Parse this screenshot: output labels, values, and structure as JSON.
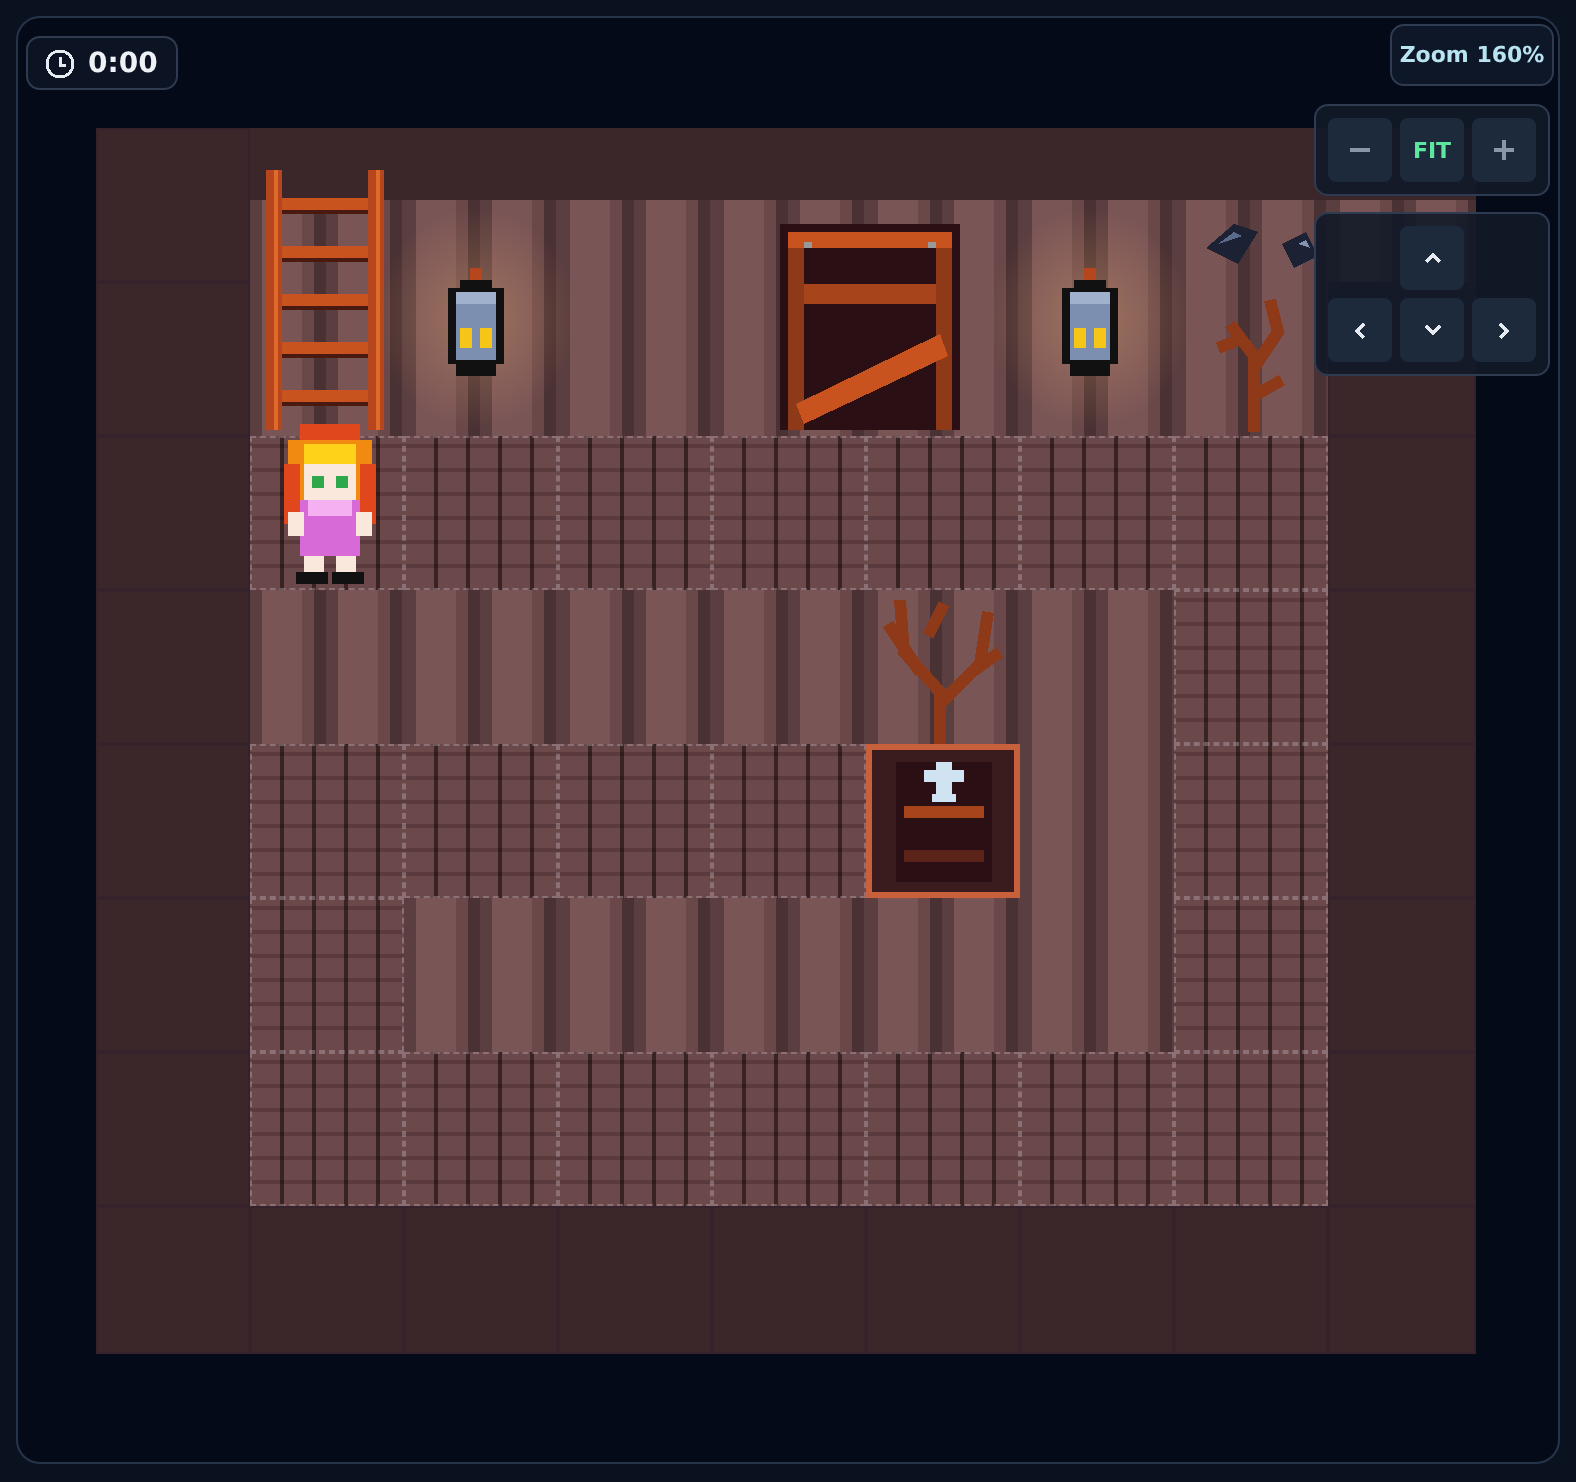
{
  "timer": {
    "value": "0:00"
  },
  "zoom": {
    "label": "Zoom 160%"
  },
  "zoom_controls": [
    {
      "kind": "minus"
    },
    {
      "kind": "fit",
      "label": "FIT"
    },
    {
      "kind": "plus"
    }
  ],
  "pan_controls": [
    {
      "kind": "up"
    },
    {
      "kind": "left"
    },
    {
      "kind": "down"
    },
    {
      "kind": "right"
    }
  ]
}
